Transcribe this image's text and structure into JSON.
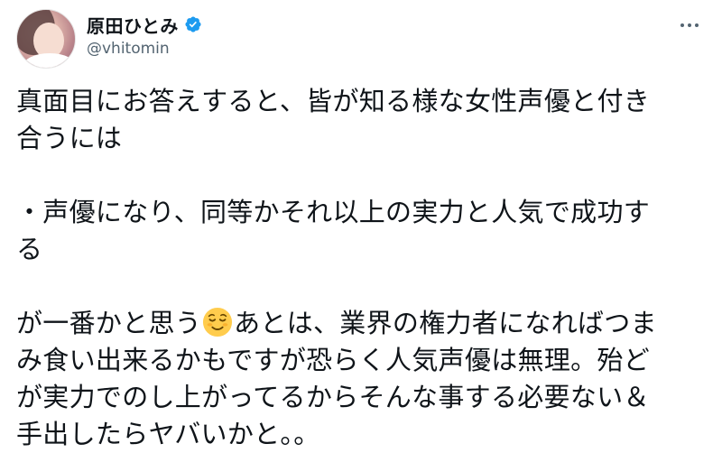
{
  "author": {
    "display_name": "原田ひとみ",
    "handle": "@vhitomin",
    "verified": true
  },
  "colors": {
    "text": "#0f1419",
    "secondary": "#536471",
    "verified_badge": "#1d9bf0",
    "emoji_face": "#ffcc4d"
  },
  "icons": {
    "more": "more-options-icon",
    "verified": "verified-badge-icon",
    "emoji": "relieved-face-emoji"
  },
  "tweet": {
    "line1": "真面目にお答えすると、皆が知る様な女性声優と付き",
    "line2": "合うには",
    "line3": "・声優になり、同等かそれ以上の実力と人気で成功す",
    "line4": "る",
    "line5_a": "が一番かと思う",
    "line5_b": "あとは、業界の権力者になればつま",
    "line6": "み食い出来るかもですが恐らく人気声優は無理。殆ど",
    "line7": "が実力でのし上がってるからそんな事する必要ない＆",
    "line8": "手出したらヤバいかと。。"
  }
}
